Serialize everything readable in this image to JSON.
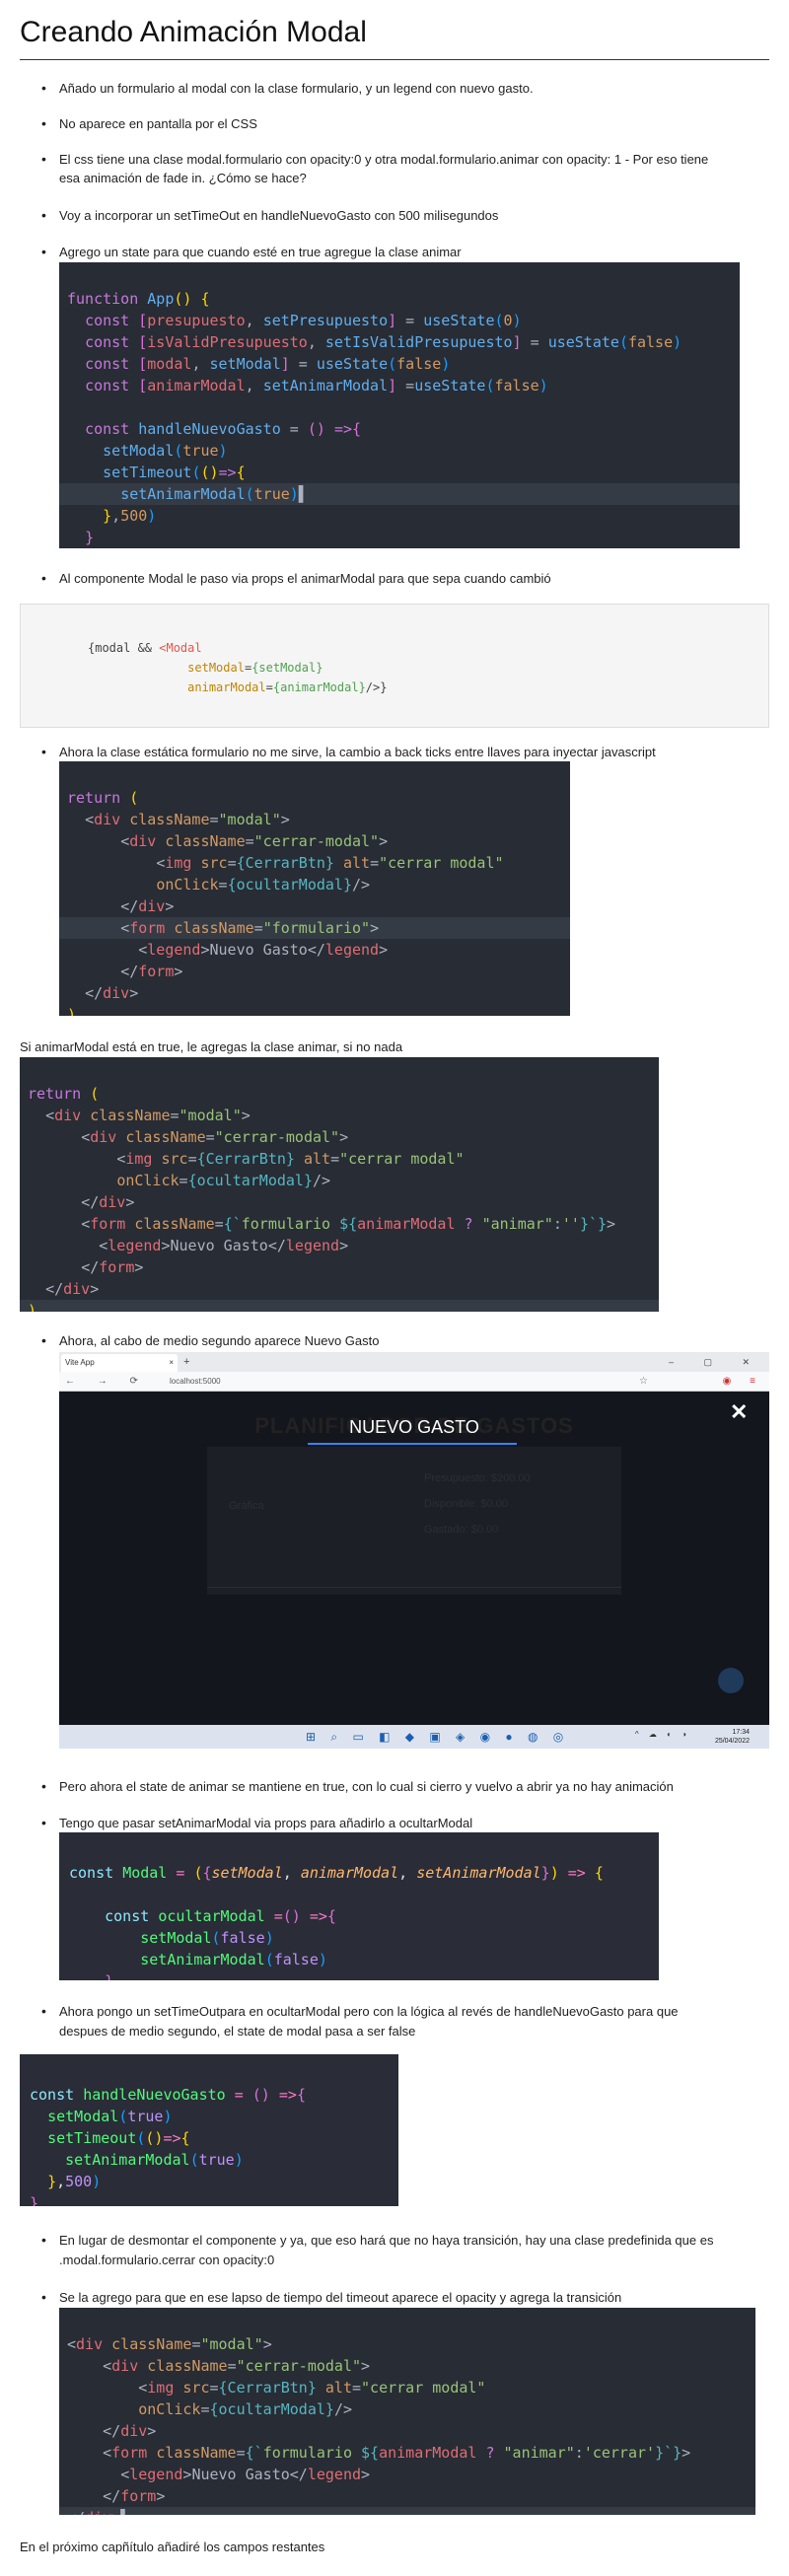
{
  "title": "Creando Animación Modal",
  "bullets": [
    "Añado un formulario al modal con la clase formulario, y un legend con nuevo gasto.",
    "No aparece en pantalla por el CSS",
    "El css tiene una clase modal.formulario con opacity:0 y otra modal.formulario.animar con opacity: 1 - Por eso tiene",
    "esa animación de fade in. ¿Cómo se hace?",
    "Voy a incorporar un setTimeOut en handleNuevoGasto con 500 milisegundos",
    "Agrego un state para que cuando esté en true agregue la clase animar",
    "Al componente Modal le paso via props el animarModal para que sepa cuando cambió",
    "Ahora la clase estática formulario no me sirve, la cambio a back ticks entre llaves para inyectar javascript",
    "Ahora, al cabo de medio segundo aparece Nuevo Gasto",
    "Pero ahora el state de animar se mantiene en true, con lo cual si cierro y vuelvo a abrir ya no hay animación",
    "Tengo que pasar setAnimarModal via props para añadirlo a ocultarModal",
    "Ahora pongo un setTimeOutpara en ocultarModal pero con la lógica al revés de handleNuevoGasto para que",
    "despues de medio segundo, el state de modal pasa a ser false",
    "En lugar de desmontar el componente y ya, que eso hará que no haya transición, hay una clase predefinida que es",
    ".modal.formulario.cerrar con opacity:0",
    "Se la agrego para que en ese lapso de tiempo del timeout aparece el opacity y agrega la transición"
  ],
  "plain": {
    "p1": "Si animarModal está en true, le agregas la clase animar, si no nada",
    "p2": "En el próximo capñítulo añadiré los campos restantes"
  },
  "browser": {
    "tab_title": "Vite App",
    "tab_close": "×",
    "new_tab": "+",
    "window_controls": "– ▢ ✕",
    "nav": "← → ⟳",
    "url": "localhost:5000",
    "star": "☆",
    "ext": "◉ ≡",
    "bg_title": "PLANIFICADOR DE GASTOS",
    "panel_labels": [
      "Presupuesto: $200.00",
      "Disponible: $0.00",
      "Gastado: $0.00",
      "Gráfica"
    ],
    "modal_title": "NUEVO GASTO",
    "close": "✕",
    "taskbar_icons": "⊞ ⌕ ▭ ◧ ◆ ▣ ◈ ◉ ● ◍ ◎",
    "tray": "^ ☁ ◐ ◑",
    "clock_time": "17:34",
    "clock_date": "25/04/2022"
  }
}
